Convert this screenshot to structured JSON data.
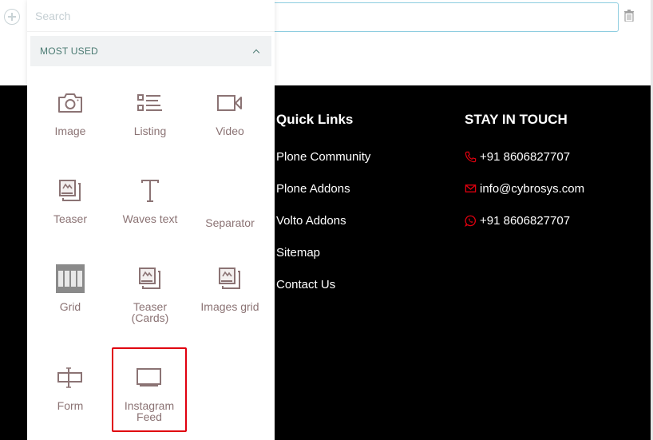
{
  "editor": {
    "add_block_label": "add block",
    "delete_label": "delete block"
  },
  "chooser": {
    "search_placeholder": "Search",
    "section_title": "MOST USED",
    "blocks": [
      {
        "label": "Image",
        "icon": "camera-icon"
      },
      {
        "label": "Listing",
        "icon": "list-icon"
      },
      {
        "label": "Video",
        "icon": "video-icon"
      },
      {
        "label": "Teaser",
        "icon": "teaser-icon"
      },
      {
        "label": "Waves text",
        "icon": "text-icon"
      },
      {
        "label": "Separator",
        "icon": ""
      },
      {
        "label": "Grid",
        "icon": "grid-icon"
      },
      {
        "label": "Teaser (Cards)",
        "icon": "teaser-cards-icon"
      },
      {
        "label": "Images grid",
        "icon": "images-grid-icon"
      },
      {
        "label": "Form",
        "icon": "form-icon"
      },
      {
        "label": "Instagram Feed",
        "icon": "screen-icon",
        "selected": true
      }
    ]
  },
  "footer": {
    "quick_links": {
      "title": "Quick Links",
      "links": [
        "Plone Community",
        "Plone Addons",
        "Volto Addons",
        "Sitemap",
        "Contact Us"
      ]
    },
    "stay_in_touch": {
      "title": "STAY IN TOUCH",
      "phone": "+91 8606827707",
      "email": "info@cybrosys.com",
      "whatsapp": "+91 8606827707"
    },
    "accent_color": "#e0000f"
  }
}
